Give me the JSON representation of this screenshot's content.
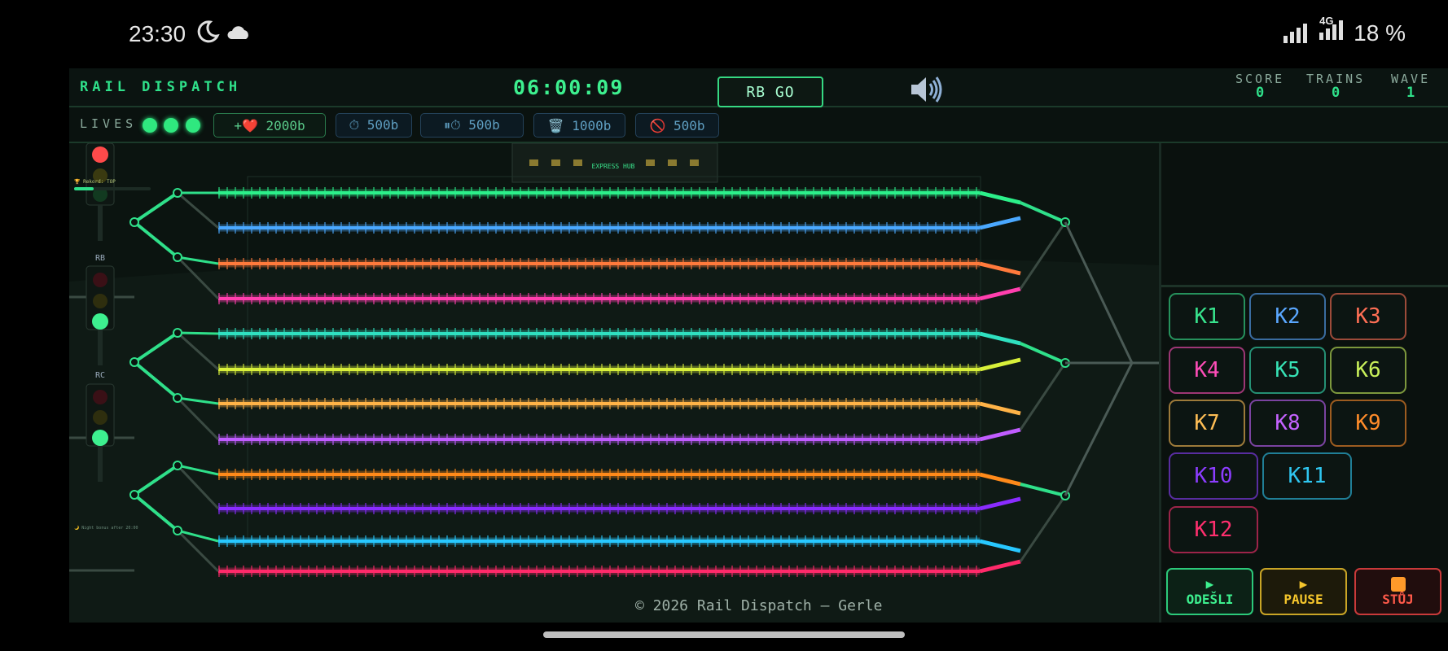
{
  "status_bar": {
    "time": "23:30",
    "moon_icon": "moon-icon",
    "cloud_icon": "cloud-icon",
    "network": "4G",
    "battery": "18 %"
  },
  "header": {
    "title": "RAIL DISPATCH",
    "clock": "06:00:09",
    "rb_go_label": "RB GO",
    "speaker_icon": "speaker-icon",
    "score_label": "SCORE",
    "score_value": "0",
    "trains_label": "TRAINS",
    "trains_value": "0",
    "wave_label": "WAVE",
    "wave_value": "1"
  },
  "powerups": {
    "lives_label": "LIVES",
    "lives_count": 3,
    "items": [
      {
        "label": "+❤️ 2000b",
        "icon": "heart-icon"
      },
      {
        "label": "⏱ 500b",
        "icon": "timer-icon"
      },
      {
        "label": "⏸⏱ 500b",
        "icon": "pause-timer-icon"
      },
      {
        "label": "🗑️ 1000b",
        "icon": "trash-icon"
      },
      {
        "label": "🚫 500b",
        "icon": "block-icon"
      }
    ]
  },
  "board": {
    "station_sign": "EXPRESS HUB",
    "signals": [
      {
        "label": "",
        "state": "red"
      },
      {
        "label": "RB",
        "state": "green"
      },
      {
        "label": "RC",
        "state": "green"
      }
    ],
    "record_text": "🏆 Rekord: TOP",
    "night_note": "🌙 Night bonus after 20:00",
    "track_colors": [
      "#2cf08a",
      "#4aa8ff",
      "#ff7a3c",
      "#ff3fae",
      "#2fe0c0",
      "#d8f03a",
      "#ffb347",
      "#c05cff",
      "#ff8a1a",
      "#8a2cff",
      "#28c8ff",
      "#ff2a6a"
    ]
  },
  "controls": {
    "track_buttons": [
      {
        "label": "K1",
        "color": "#38e58e"
      },
      {
        "label": "K2",
        "color": "#5aa7ff"
      },
      {
        "label": "K3",
        "color": "#ff6f55"
      },
      {
        "label": "K4",
        "color": "#ff4db8"
      },
      {
        "label": "K5",
        "color": "#37e3b6"
      },
      {
        "label": "K6",
        "color": "#c9f05a"
      },
      {
        "label": "K7",
        "color": "#ffbe55"
      },
      {
        "label": "K8",
        "color": "#c563ff"
      },
      {
        "label": "K9",
        "color": "#ff8c2a"
      },
      {
        "label": "K10",
        "color": "#8c3dff"
      },
      {
        "label": "K11",
        "color": "#2fc6f0"
      },
      {
        "label": "K12",
        "color": "#ff2f6e"
      }
    ],
    "send_label": "ODEŠLI",
    "pause_label": "PAUSE",
    "stop_label": "STŮJ"
  },
  "footer": "© 2026 Rail Dispatch — Gerle"
}
